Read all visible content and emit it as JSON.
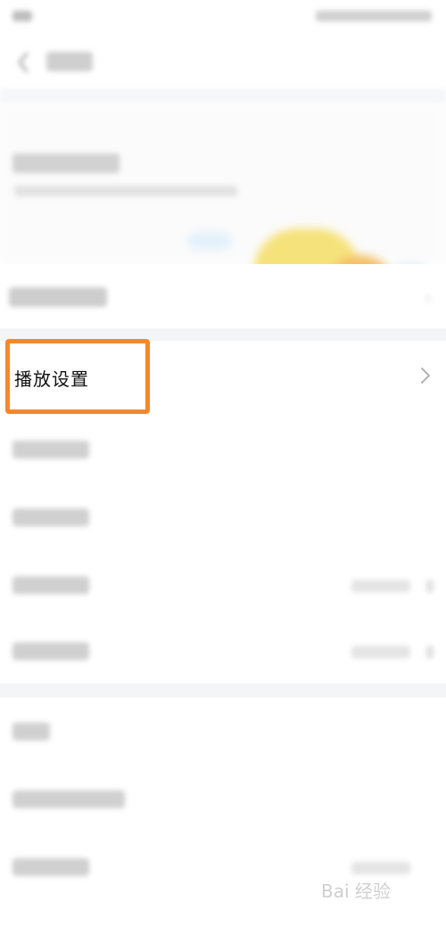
{
  "statusbar": {},
  "header": {
    "back_icon": "back-arrow-icon"
  },
  "banner": {},
  "rows": {
    "playback_settings": {
      "label": "播放设置",
      "chevron_icon": "chevron-right-icon"
    }
  },
  "highlight": {
    "color": "#f5882a"
  },
  "watermark": {
    "text": "Bai 经验"
  }
}
